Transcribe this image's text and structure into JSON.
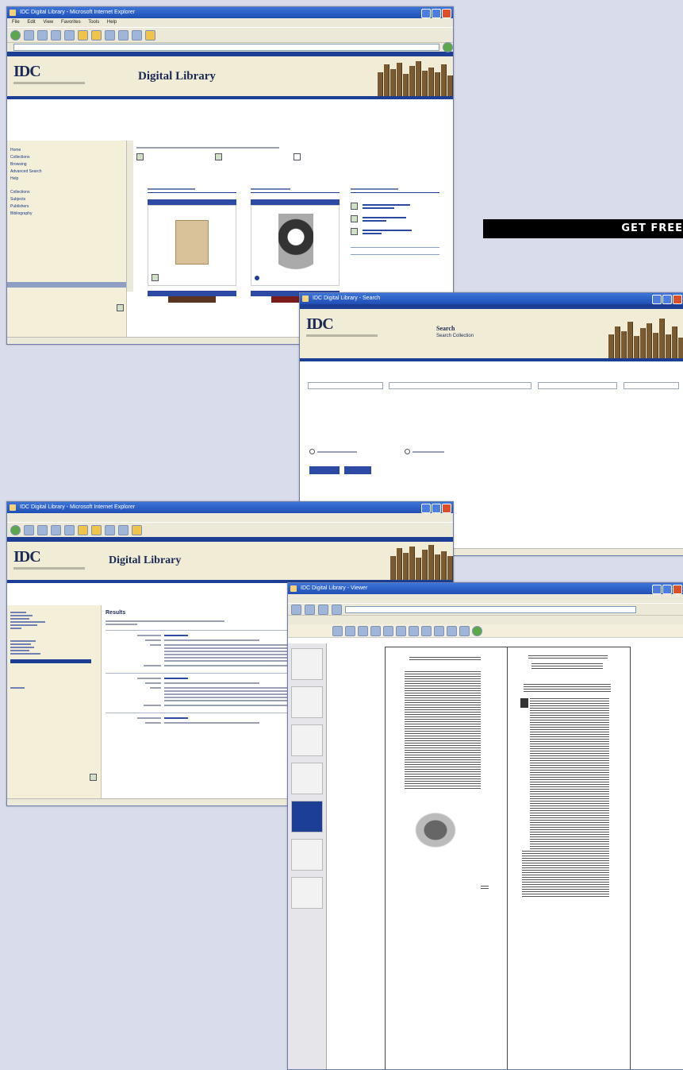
{
  "cta": {
    "label": "GET FREE"
  },
  "window1": {
    "title": "IDC Digital Library - Microsoft Internet Explorer",
    "menu": [
      "File",
      "Edit",
      "View",
      "Favorites",
      "Tools",
      "Help"
    ],
    "logo": "IDC",
    "banner_title": "Digital Library",
    "sidebar": [
      "Home",
      "Collections",
      "Browsing",
      "Advanced Search",
      "Help",
      "",
      "Collections",
      "Subjects",
      "Publishers",
      "Bibliography"
    ]
  },
  "window2": {
    "title": "IDC Digital Library - Search",
    "logo": "IDC",
    "banner_title": "Search",
    "banner_subtitle": "Search Collection"
  },
  "window3": {
    "title": "IDC Digital Library - Microsoft Internet Explorer",
    "logo": "IDC",
    "banner_title": "Digital Library",
    "results_heading": "Results"
  },
  "window4": {
    "title": "IDC Digital Library - Viewer"
  }
}
